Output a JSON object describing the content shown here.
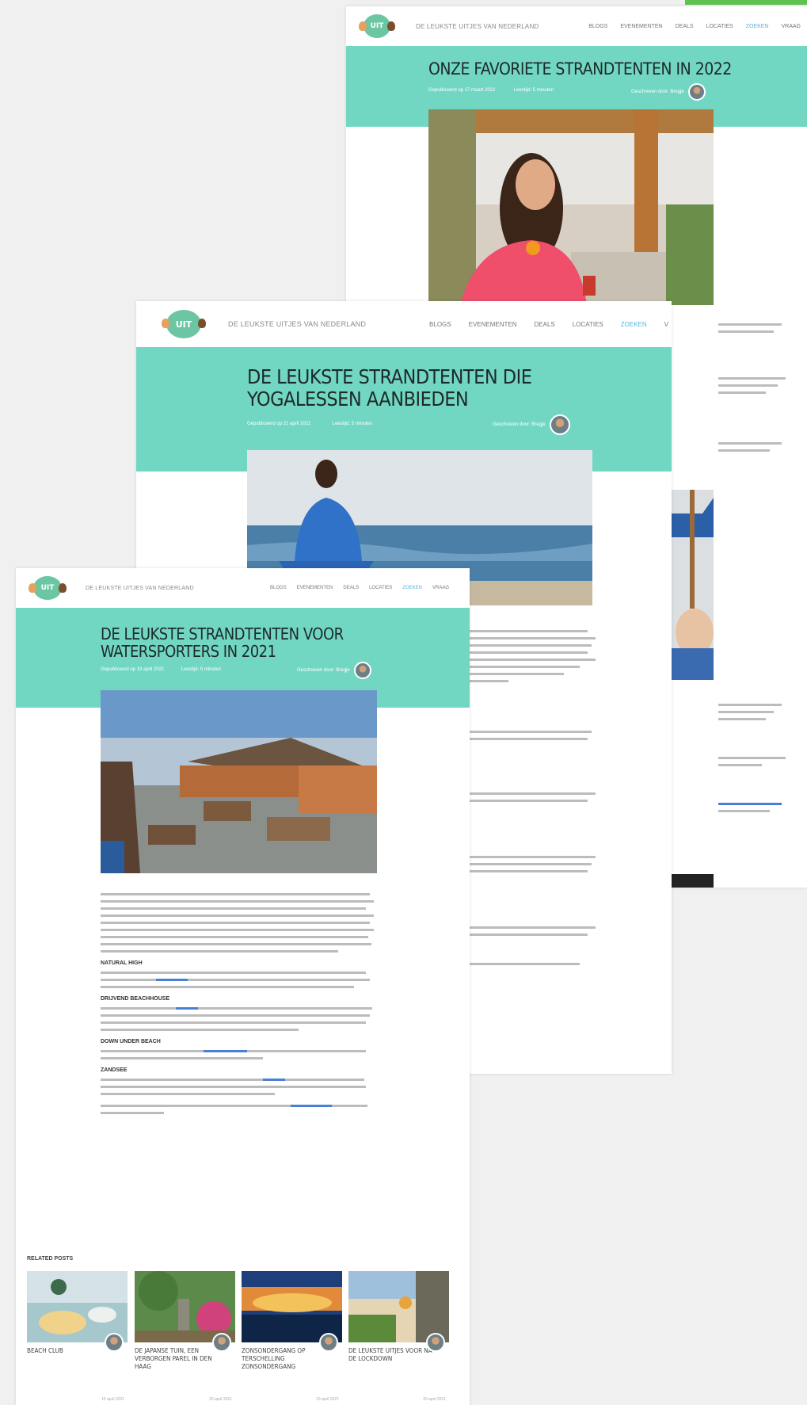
{
  "pages": {
    "back": {
      "site_tagline": "DE LEUKSTE UITJES VAN NEDERLAND",
      "menu": [
        "BLOGS",
        "EVENEMENTEN",
        "DEALS",
        "LOCATIES",
        "ZOEKEN",
        "VRAAG"
      ],
      "title": "ONZE FAVORIETE STRANDTENTEN IN 2022",
      "meta_date": "Gepubliceerd op 17 maart 2022",
      "meta_read": "Leestijd: 5 minuten",
      "author": "Geschreven door: Bregje"
    },
    "middle": {
      "site_tagline": "DE LEUKSTE UITJES VAN NEDERLAND",
      "menu": [
        "BLOGS",
        "EVENEMENTEN",
        "DEALS",
        "LOCATIES",
        "ZOEKEN",
        "V"
      ],
      "title_line1": "DE LEUKSTE STRANDTENTEN DIE",
      "title_line2": "YOGALESSEN AANBIEDEN",
      "meta_date": "Gepubliceerd op 21 april 2021",
      "meta_read": "Leestijd: 5 minuten",
      "author": "Geschreven door: Bregje"
    },
    "front": {
      "site_tagline": "DE LEUKSTE UITJES VAN NEDERLAND",
      "menu": [
        "BLOGS",
        "EVENEMENTEN",
        "DEALS",
        "LOCATIES",
        "ZOEKEN",
        "VRAAG"
      ],
      "title_line1": "DE LEUKSTE STRANDTENTEN VOOR",
      "title_line2": "WATERSPORTERS IN 2021",
      "meta_date": "Gepubliceerd op 19 april 2021",
      "meta_read": "Leestijd: 5 minuten",
      "author": "Geschreven door: Bregje",
      "sections": [
        "NATURAL HIGH",
        "DRIJVEND BEACHHOUSE",
        "DOWN UNDER BEACH",
        "ZANDSEE"
      ],
      "related_heading": "RELATED POSTS",
      "related": [
        {
          "title": "BEACH CLUB",
          "date": "19 april 2021"
        },
        {
          "title": "DE JAPANSE TUIN, EEN VERBORGEN PAREL IN DEN HAAG",
          "date": "20 april 2021"
        },
        {
          "title": "ZONSONDERGANG OP TERSCHELLING ZONSONDERGANG",
          "date": "19 april 2021"
        },
        {
          "title": "DE LEUKSTE UITJES VOOR NA DE LOCKDOWN",
          "date": "20 april 2021"
        }
      ]
    }
  },
  "colors": {
    "hero": "#72d7c2",
    "accent_link": "#4a7fd6",
    "menu_active": "#55b6dd",
    "corner_bar": "#5ec24f"
  }
}
